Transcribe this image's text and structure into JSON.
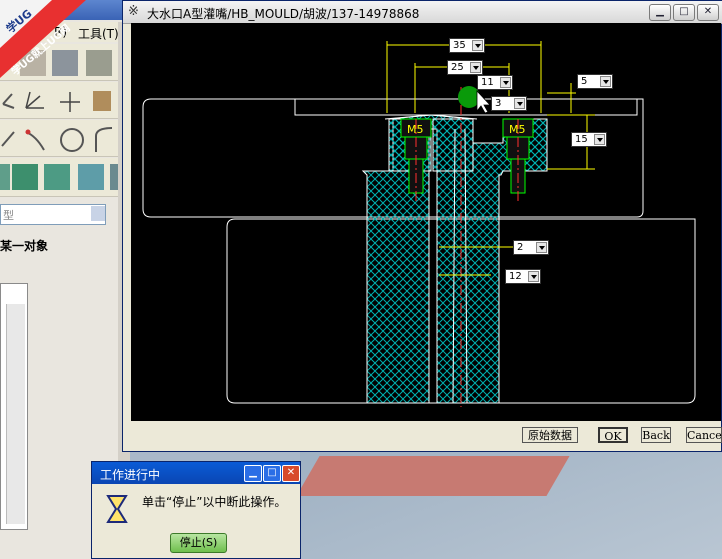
{
  "background_app": {
    "menu": {
      "tools_label": "工具(T)",
      "cut_label": "R)"
    },
    "combo_text": "型",
    "select_label": "某一对象"
  },
  "badge": {
    "text1": "学UG",
    "text2": "学UG就上UG网"
  },
  "dialog": {
    "title": "大水口A型灌嘴/HB_MOULD/胡波/137-14978868",
    "buttons": {
      "original_data": "原始数据",
      "ok": "OK",
      "back": "Back",
      "cancel": "Cancel"
    },
    "dims": [
      {
        "id": "d35",
        "value": "35"
      },
      {
        "id": "d25",
        "value": "25"
      },
      {
        "id": "d11",
        "value": "11"
      },
      {
        "id": "d3",
        "value": "3"
      },
      {
        "id": "d5",
        "value": "5"
      },
      {
        "id": "d15",
        "value": "15"
      },
      {
        "id": "d2",
        "value": "2"
      },
      {
        "id": "d12",
        "value": "12"
      }
    ],
    "screw_label_left": "M5",
    "screw_label_right": "M5"
  },
  "progress": {
    "title": "工作进行中",
    "message": "单击“停止”以中断此操作。",
    "stop_label": "停止(S)"
  },
  "colors": {
    "drawing_line": "#ffffff",
    "centerline": "#ff0000",
    "dim_line": "#ffff00",
    "hatch": "#00c0c0",
    "screw": "#00ff00"
  }
}
